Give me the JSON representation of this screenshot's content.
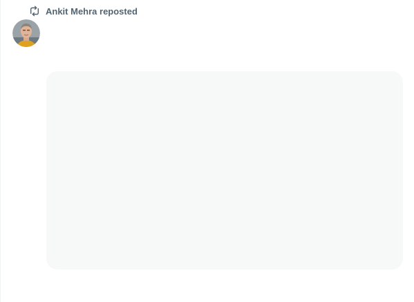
{
  "post": {
    "repost_label": "Ankit Mehra reposted",
    "repost_icon": "repost-icon",
    "avatar_icon": "avatar",
    "colors": {
      "secondary_text": "#536471",
      "media_background": "#f7f8f8",
      "border": "#eff3f4"
    }
  }
}
